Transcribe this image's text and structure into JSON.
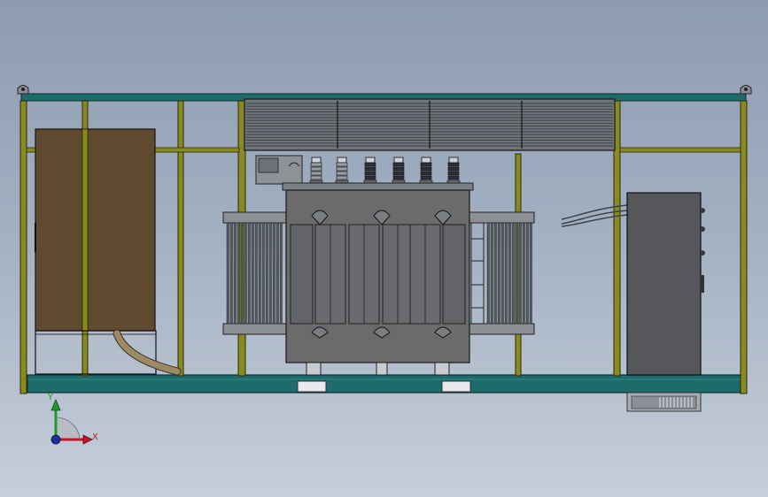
{
  "viewport": {
    "background_top": "#8d9cb2",
    "background_bottom": "#c6ceda"
  },
  "colors": {
    "frame_teal": "#1e6b6b",
    "frame_olive": "#8a8a22",
    "cabinet_brown": "#5f4a30",
    "transformer_body": "#6b6b6b",
    "radiator_fins": "#555a5e",
    "control_cabinet": "#55575b",
    "hose": "#9c8a66"
  },
  "triad": {
    "x_label": "X",
    "y_label": "Y",
    "x_color": "#c0162a",
    "y_color": "#1f9a2a",
    "z_color": "#1c2f9c"
  },
  "components": {
    "bushings_count": 6,
    "hv_bushings_count": 2,
    "lower_terminals_count": 3,
    "upper_terminals_count": 3
  }
}
